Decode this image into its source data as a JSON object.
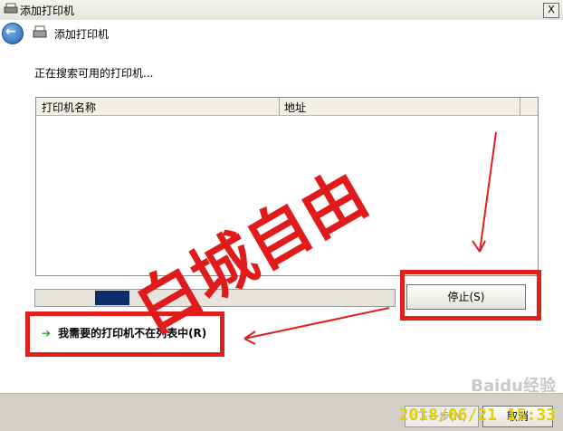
{
  "window": {
    "title": "添加打印机",
    "close_label": "X"
  },
  "nav": {
    "title": "添加打印机"
  },
  "status": {
    "message": "正在搜索可用的打印机..."
  },
  "table": {
    "columns": [
      "打印机名称",
      "地址"
    ]
  },
  "progress": {
    "value": 0.2
  },
  "buttons": {
    "stop": "停止(S)",
    "next": "下一步(N)",
    "cancel": "取消"
  },
  "links": {
    "not_listed": "我需要的打印机不在列表中(R)"
  },
  "overlay": {
    "watermark": "白城自由",
    "baidu": "Baidu经验",
    "timestamp": "2018/06/21 15:33"
  },
  "colors": {
    "annotation": "#e0201b",
    "progress_fill": "#0b2e6b"
  }
}
